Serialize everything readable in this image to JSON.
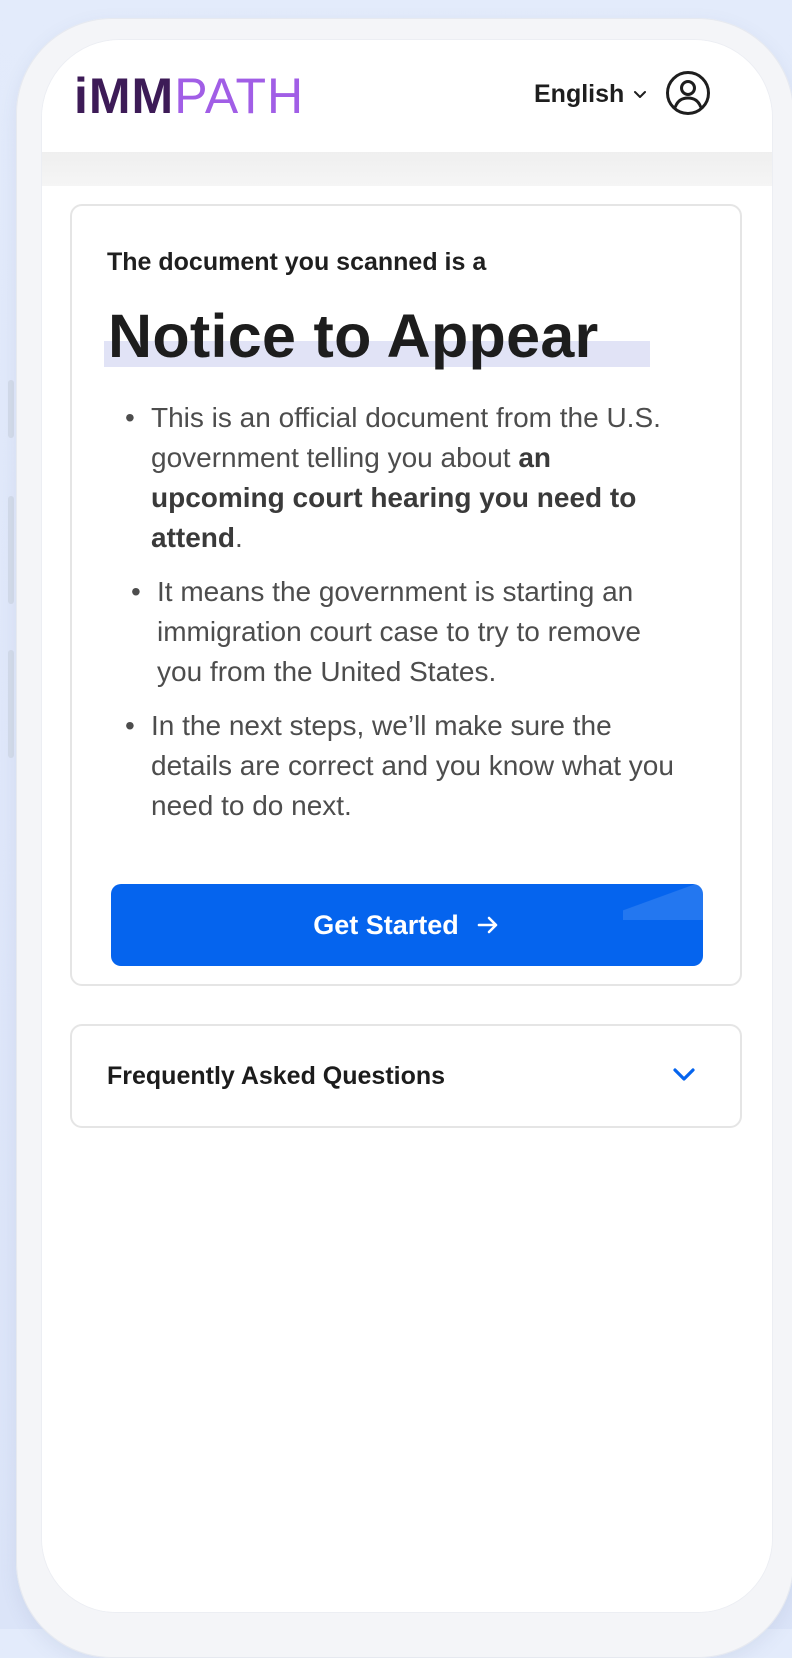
{
  "header": {
    "logo_bold": "iMM",
    "logo_light": "PATH",
    "language": "English"
  },
  "result": {
    "intro": "The document you scanned is a",
    "title": "Notice to Appear",
    "bullets": [
      {
        "text_1": "This is an official document from the U.S. government telling you about ",
        "bold": "an upcoming court hearing you need to attend",
        "text_2": "."
      },
      {
        "text": "It means the government is starting an immigration court case to try to remove you from the United States."
      },
      {
        "text": "In the next steps, we’ll make sure the details are correct and you know what you need to do next."
      }
    ],
    "cta_label": "Get Started"
  },
  "faq": {
    "label": "Frequently Asked Questions"
  },
  "colors": {
    "brand_dark": "#3d1b57",
    "brand_light": "#a15ee6",
    "primary_button": "#0564ee",
    "title_highlight": "#e1e3f6",
    "chevron": "#0564ee"
  },
  "icons": {
    "language_dropdown": "chevron-down-icon",
    "profile": "user-circle-icon",
    "cta": "arrow-right-icon",
    "faq": "chevron-down-icon"
  }
}
